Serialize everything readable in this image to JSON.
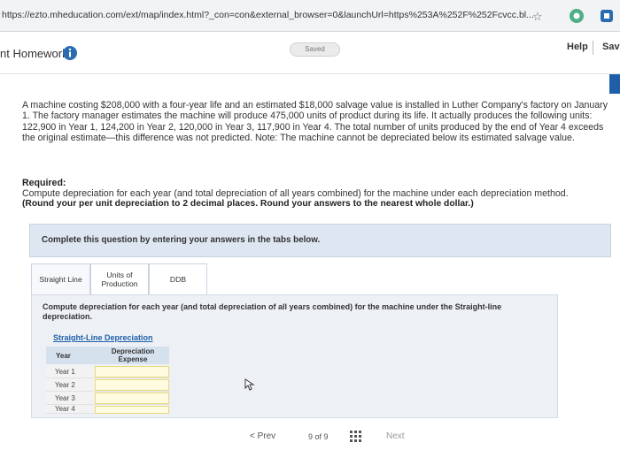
{
  "browser": {
    "url": "https://ezto.mheducation.com/ext/map/index.html?_con=con&external_browser=0&launchUrl=https%253A%252F%252Fcvcc.bl..."
  },
  "header": {
    "title": "nt Homework",
    "saved_label": "Saved",
    "help_label": "Help",
    "save_label": "Sav"
  },
  "problem": {
    "text": "A machine costing $208,000 with a four-year life and an estimated $18,000 salvage value is installed in Luther Company's factory on January 1. The factory manager estimates the machine will produce 475,000 units of product during its life. It actually produces the following units: 122,900 in Year 1, 124,200 in Year 2, 120,000 in Year 3, 117,900 in Year 4. The total number of units produced by the end of Year 4 exceeds the original estimate—this difference was not predicted. Note: The machine cannot be depreciated below its estimated salvage value.",
    "required_heading": "Required:",
    "required_text": "Compute depreciation for each year (and total depreciation of all years combined) for the machine under each depreciation method.",
    "required_note": "(Round your per unit depreciation to 2 decimal places. Round your answers to the nearest whole dollar.)"
  },
  "instruction": "Complete this question by entering your answers in the tabs below.",
  "tabs": [
    {
      "label": "Straight Line"
    },
    {
      "label": "Units of Production"
    },
    {
      "label": "DDB"
    }
  ],
  "panel": {
    "compute_text": "Compute depreciation for each year (and total depreciation of all years combined) for the machine under the Straight-line depreciation.",
    "table_caption": "Straight-Line Depreciation",
    "col_year": "Year",
    "col_expense": "Depreciation Expense",
    "rows": [
      {
        "year": "Year 1",
        "value": ""
      },
      {
        "year": "Year 2",
        "value": ""
      },
      {
        "year": "Year 3",
        "value": ""
      },
      {
        "year": "Year 4",
        "value": ""
      }
    ]
  },
  "pager": {
    "prev_label": "< Prev",
    "page_indicator": "9 of 9",
    "next_label": "Next"
  },
  "colors": {
    "accent": "#1f5fa8",
    "panel_bg": "#dde6f1",
    "input_bg": "#fffbe0"
  }
}
